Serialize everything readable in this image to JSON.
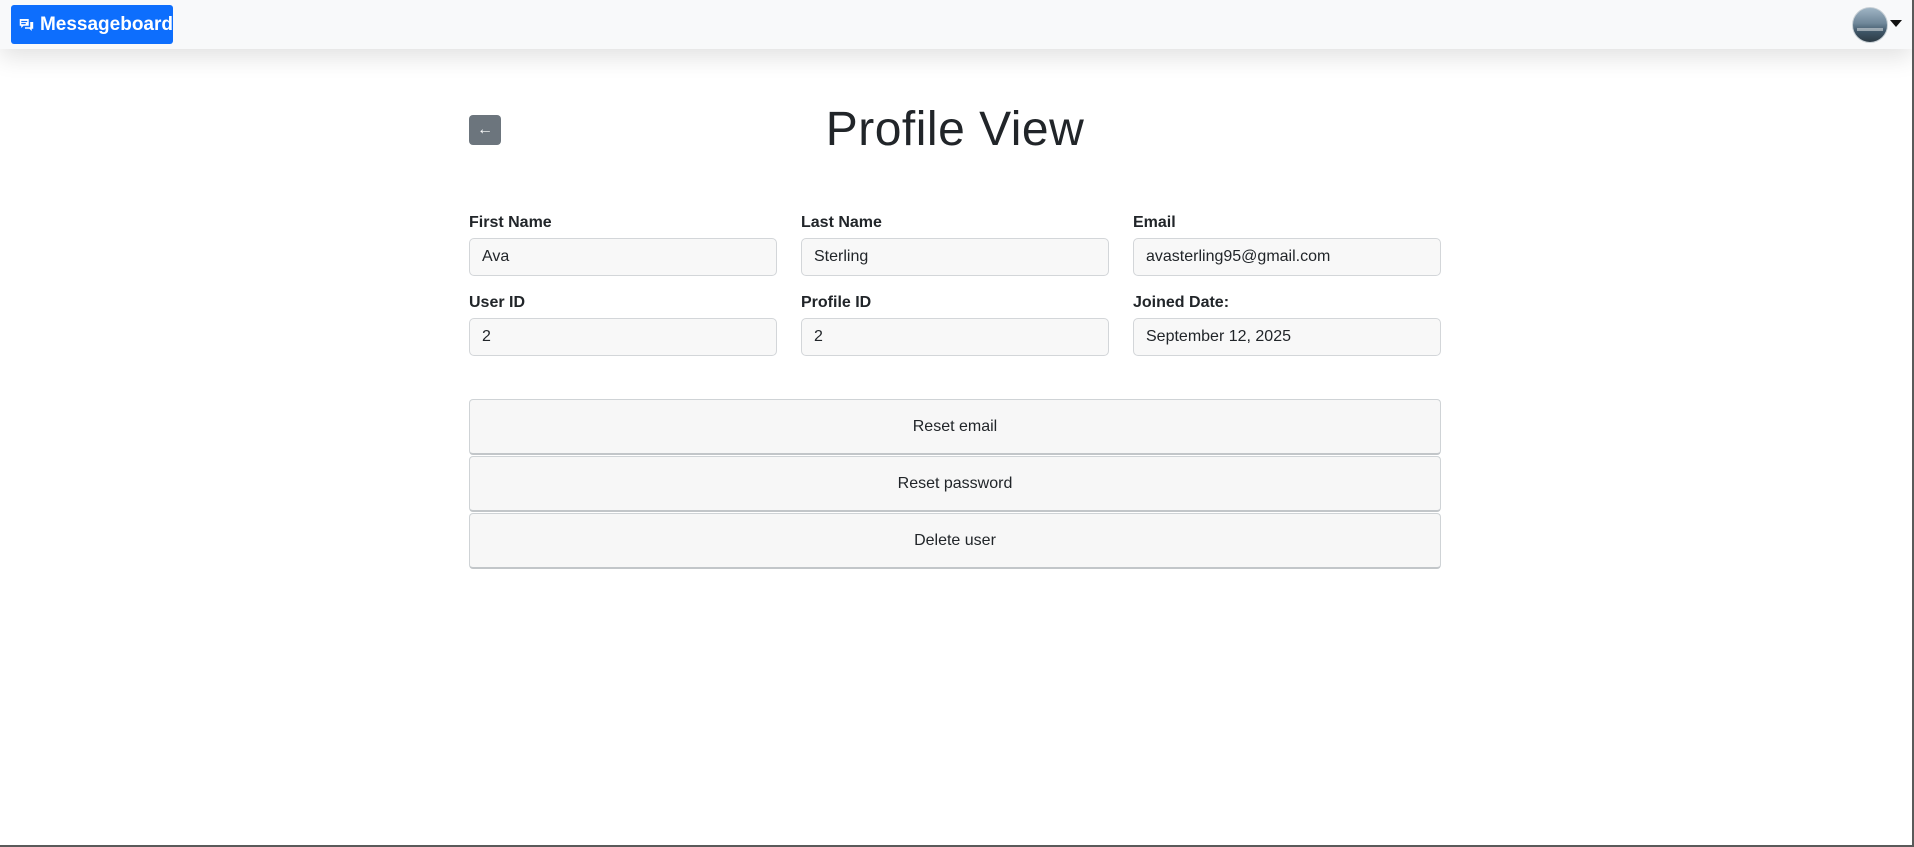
{
  "navbar": {
    "brand_label": "Messageboard",
    "brand_icon": "chat-bubbles-icon",
    "avatar_icon": "user-avatar",
    "menu_icon": "caret-down-icon"
  },
  "page": {
    "title": "Profile View",
    "back_label": "←"
  },
  "fields": {
    "first_name": {
      "label": "First Name",
      "value": "Ava"
    },
    "last_name": {
      "label": "Last Name",
      "value": "Sterling"
    },
    "email": {
      "label": "Email",
      "value": "avasterling95@gmail.com"
    },
    "user_id": {
      "label": "User ID",
      "value": "2"
    },
    "profile_id": {
      "label": "Profile ID",
      "value": "2"
    },
    "joined_date": {
      "label": "Joined Date:",
      "value": "September 12, 2025"
    }
  },
  "actions": {
    "reset_email": "Reset email",
    "reset_password": "Reset password",
    "delete_user": "Delete user"
  },
  "colors": {
    "brand": "#0d6efd",
    "back_button": "#6c757d",
    "navbar_bg": "#f8f9fa"
  }
}
